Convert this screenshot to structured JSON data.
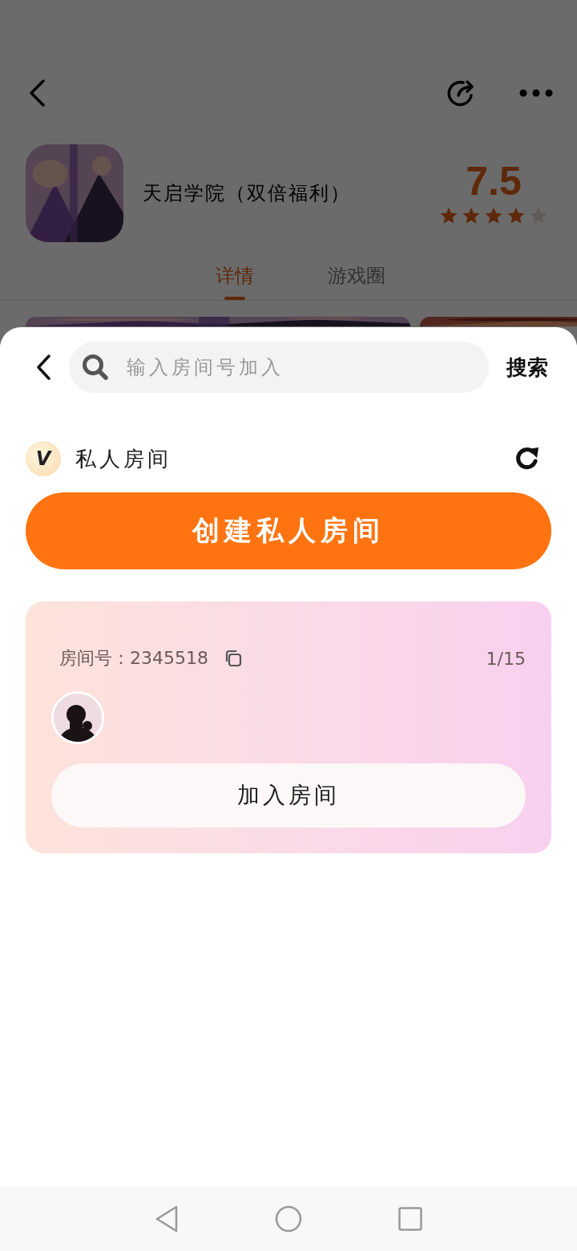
{
  "backdrop": {
    "app": {
      "title": "天启学院（双倍福利）",
      "score": "7.5",
      "stars": 4
    },
    "tabs": [
      {
        "label": "详情",
        "selected": true
      },
      {
        "label": "游戏圈",
        "selected": false
      }
    ]
  },
  "sheet": {
    "search": {
      "placeholder": "输入房间号加入"
    },
    "search_button": "搜索",
    "section": {
      "badge": "V",
      "title": "私人房间"
    },
    "create_button": "创建私人房间",
    "rooms": [
      {
        "room_number": "房间号：2345518",
        "count": "1/15",
        "join_button": "加入房间"
      }
    ]
  }
}
